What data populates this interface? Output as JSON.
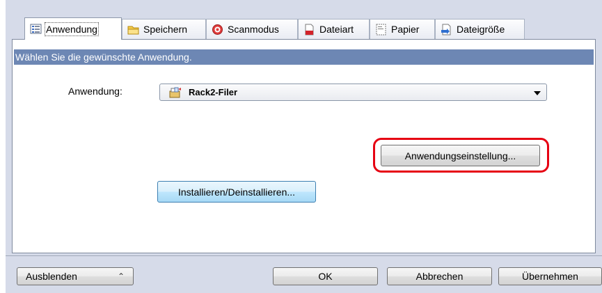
{
  "tabs": [
    {
      "label": "Anwendung",
      "icon": "application-list-icon",
      "active": true
    },
    {
      "label": "Speichern",
      "icon": "folder-icon",
      "active": false
    },
    {
      "label": "Scanmodus",
      "icon": "scan-mode-icon",
      "active": false
    },
    {
      "label": "Dateiart",
      "icon": "pdf-file-icon",
      "active": false
    },
    {
      "label": "Papier",
      "icon": "paper-icon",
      "active": false
    },
    {
      "label": "Dateigröße",
      "icon": "file-size-icon",
      "active": false
    }
  ],
  "panel": {
    "header": "Wählen Sie die gewünschte Anwendung.",
    "app_label": "Anwendung:",
    "app_select": {
      "value": "Rack2-Filer",
      "icon": "rack2-filer-icon"
    },
    "app_settings_button": "Anwendungseinstellung...",
    "install_button": "Installieren/Deinstallieren..."
  },
  "footer": {
    "hide_button": "Ausblenden",
    "ok_button": "OK",
    "cancel_button": "Abbrechen",
    "apply_button": "Übernehmen"
  },
  "colors": {
    "header_bar": "#6d87b4",
    "highlight": "#e60012",
    "window_bg": "#d6dbe9"
  }
}
